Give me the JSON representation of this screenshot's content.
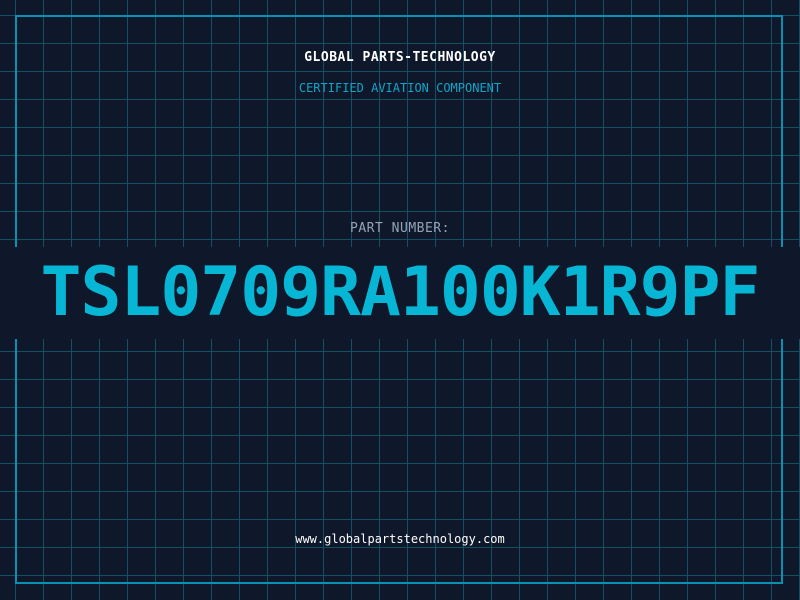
{
  "brand": {
    "name": "GLOBAL PARTS-TECHNOLOGY",
    "tagline": "CERTIFIED AVIATION COMPONENT"
  },
  "part": {
    "label": "PART NUMBER:",
    "number": "TSL0709RA100K1R9PF"
  },
  "footer": {
    "website": "www.globalpartstechnology.com"
  },
  "colors": {
    "background": "#0f172a",
    "grid": "#164e63",
    "frame": "#0891b2",
    "accent": "#06b6d4"
  }
}
